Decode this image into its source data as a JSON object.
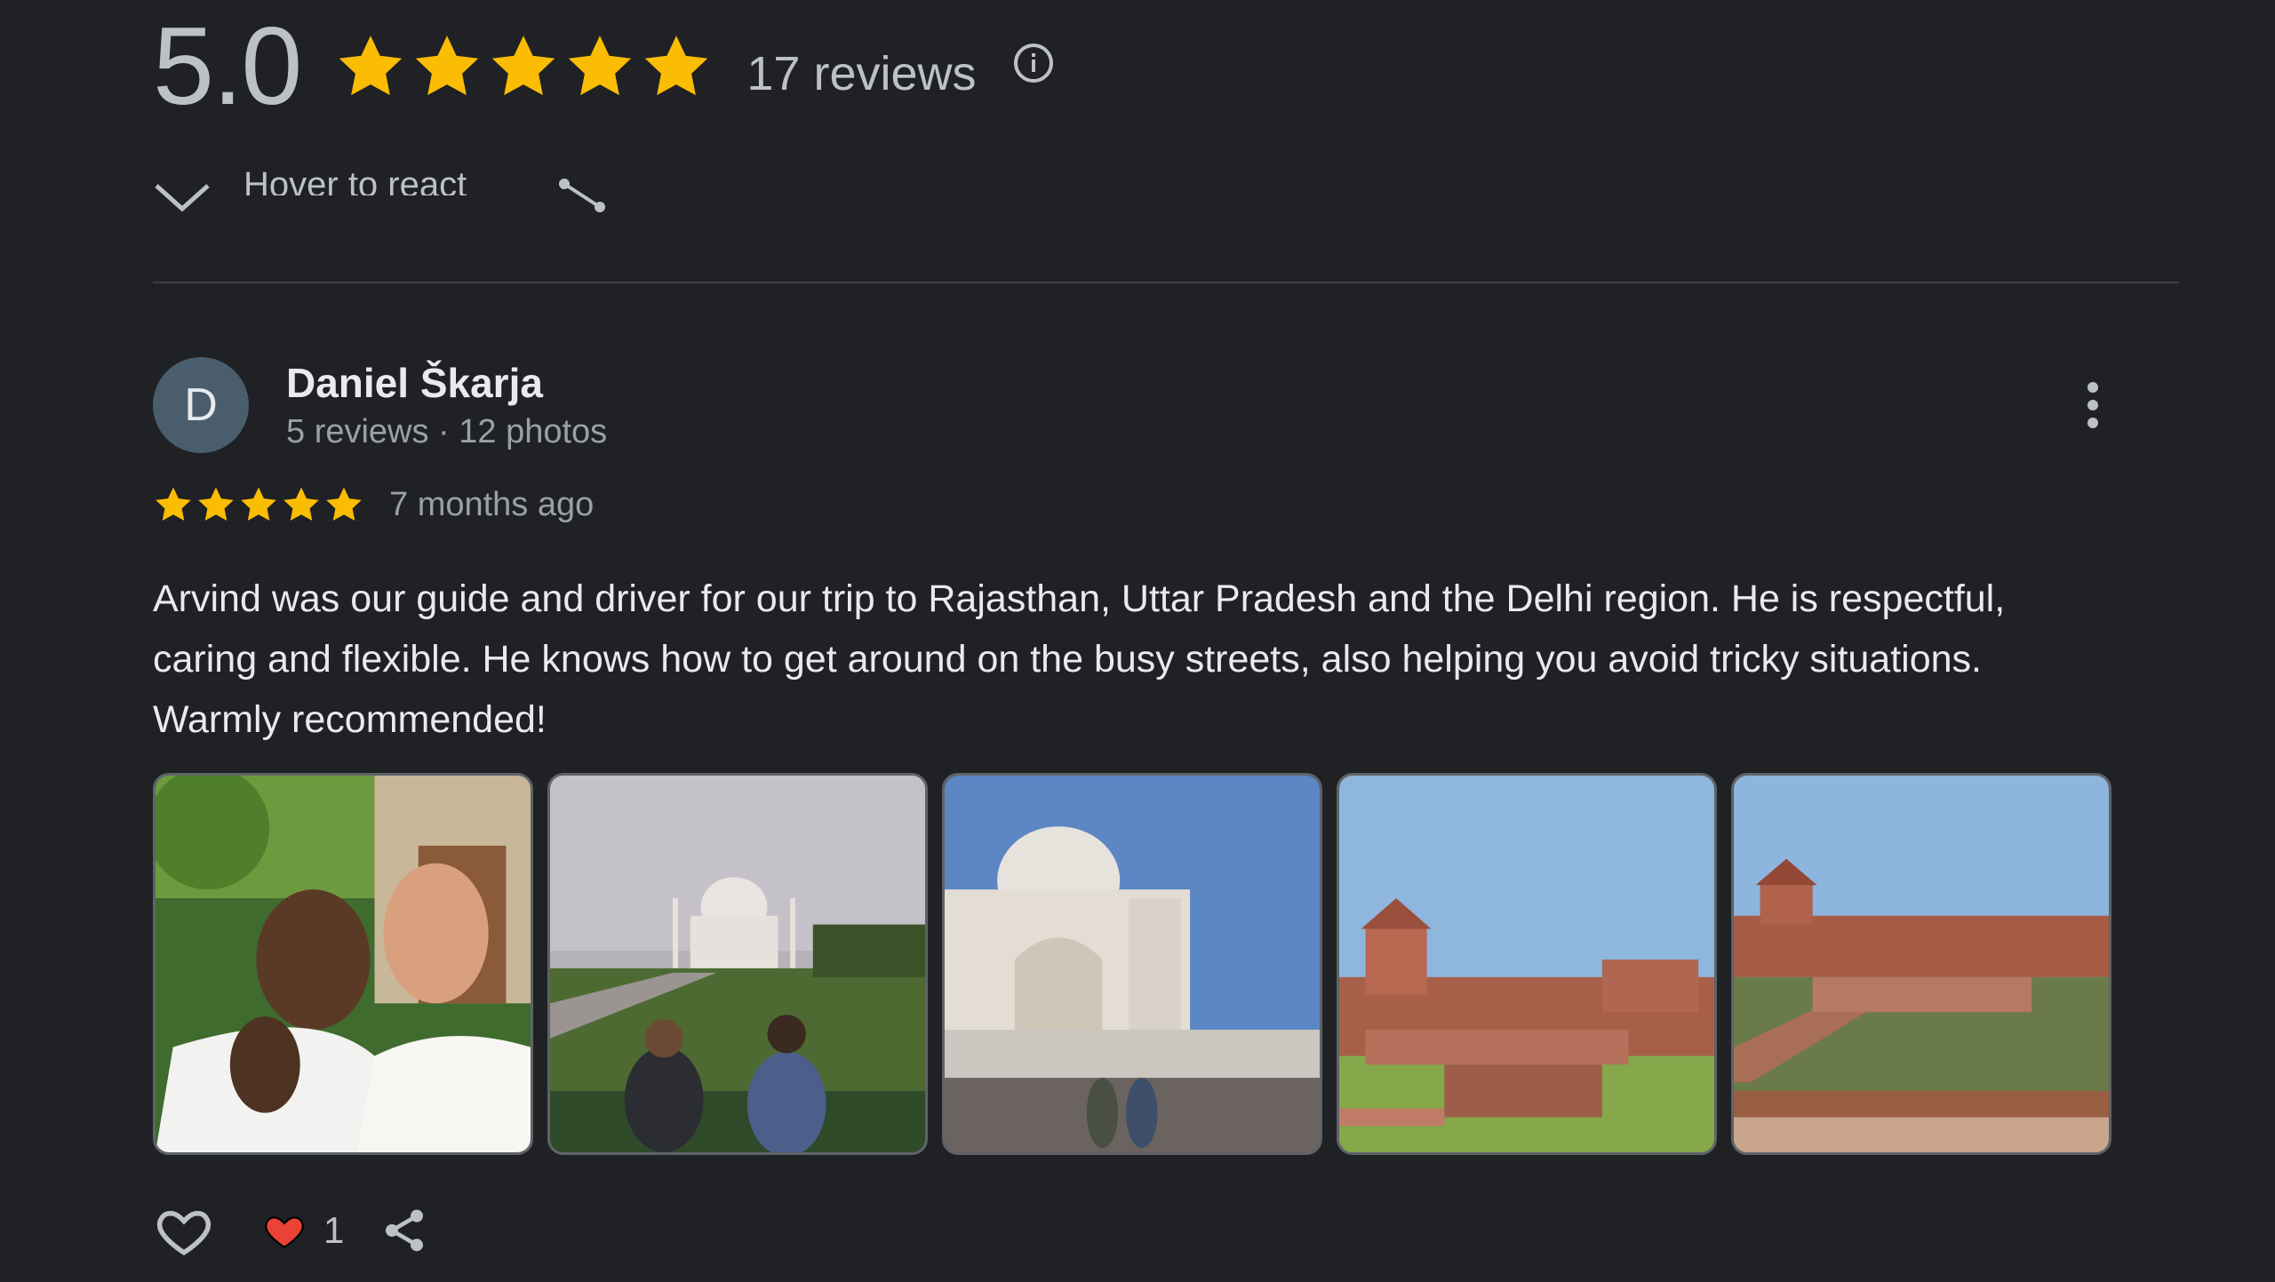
{
  "summary": {
    "score": "5.0",
    "stars": 5,
    "review_count": "17 reviews",
    "star_color": "#fbbc04"
  },
  "hover_row": {
    "label": "Hover to react"
  },
  "review": {
    "avatar_letter": "D",
    "avatar_color": "#4a5d6c",
    "name": "Daniel Škarja",
    "meta": "5 reviews · 12 photos",
    "rating": 5,
    "time": "7 months ago",
    "text": "Arvind was our guide and driver for our trip to Rajasthan, Uttar Pradesh and the Delhi region. He is respectful, caring and flexible. He knows how to get around on the busy streets, also helping you avoid tricky situations. Warmly recommended!",
    "photos": [
      "photo-guide-selfie",
      "photo-taj-mahal-garden",
      "photo-taj-mahal-closeup",
      "photo-fatehpur-sikri-pool",
      "photo-fatehpur-sikri-court"
    ],
    "reactions": {
      "like_count": "1",
      "heart_color": "#ea4335"
    }
  }
}
